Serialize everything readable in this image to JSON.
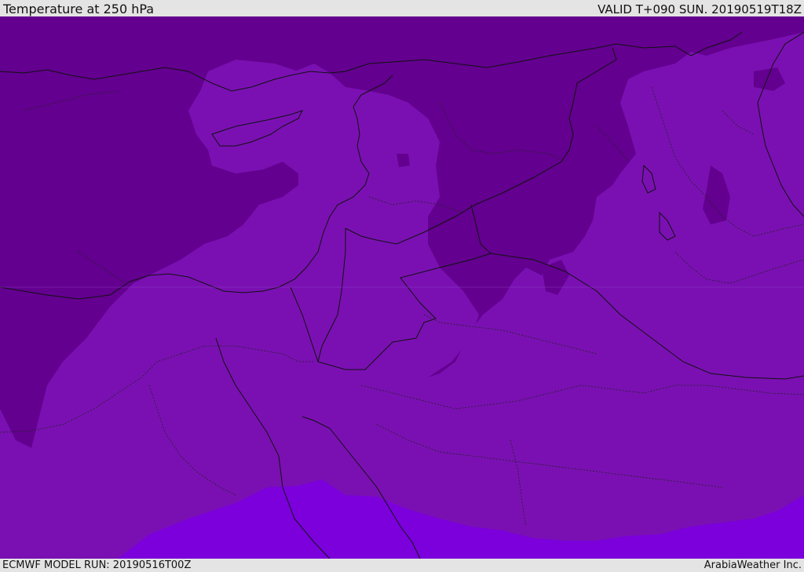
{
  "header": {
    "title": "Temperature at 250 hPa",
    "valid_time": "VALID T+090 SUN. 20190519T18Z"
  },
  "footer": {
    "model_run": "ECMWF MODEL RUN: 20190516T00Z",
    "credit": "ArabiaWeather Inc."
  },
  "colors": {
    "coldest_band": "#63008f",
    "mid_band": "#7a10b2",
    "warm_band": "#7b00dc",
    "coastline": "#111111",
    "border_dashed": "#222222"
  },
  "map": {
    "field": "temperature",
    "level": "250 hPa",
    "legend_shown": false
  }
}
